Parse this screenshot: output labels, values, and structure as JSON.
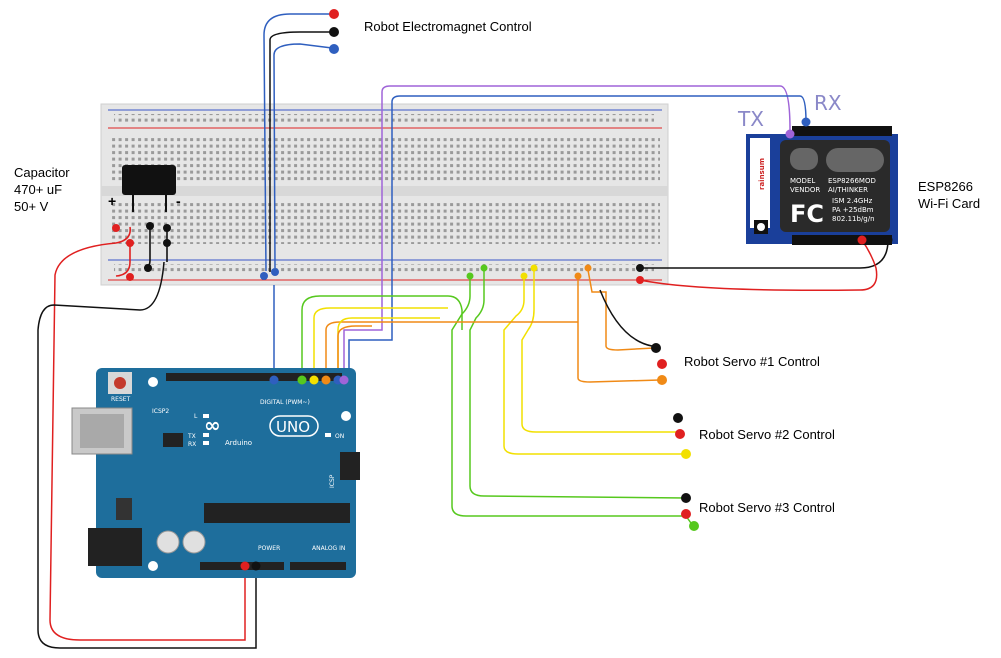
{
  "diagram": {
    "labels": {
      "electromagnet": "Robot Electromagnet Control",
      "capacitor_line1": "Capacitor",
      "capacitor_line2": "470+ uF",
      "capacitor_line3": "50+ V",
      "esp_line1": "ESP8266",
      "esp_line2": "Wi-Fi Card",
      "servo1": "Robot Servo #1 Control",
      "servo2": "Robot Servo #2 Control",
      "servo3": "Robot Servo #3 Control",
      "tx": "TX",
      "rx": "RX",
      "plus": "+",
      "minus": "-"
    },
    "arduino": {
      "logo": "UNO",
      "brand": "Arduino",
      "reset": "RESET",
      "icsp2": "ICSP2",
      "icsp": "ICSP",
      "digital": "DIGITAL (PWM~)",
      "power": "POWER",
      "analog": "ANALOG IN",
      "on": "ON",
      "l": "L",
      "tx": "TX",
      "rx": "RX"
    },
    "esp8266": {
      "brand": "rainsum",
      "model": "MODEL",
      "vendor": "VENDOR",
      "model_value": "ESP8266MOD",
      "vendor_value": "AI/THINKER",
      "spec1": "ISM 2.4GHz",
      "spec2": "PA +25dBm",
      "spec3": "802.11b/g/n",
      "fcc": "FC"
    },
    "colors": {
      "blue": "#2f5fbf",
      "red": "#e02020",
      "black": "#111111",
      "green": "#56c81e",
      "yellow": "#f2e000",
      "orange": "#f08a16",
      "purple": "#9f64d8",
      "board": "#1e6e9c",
      "breadboard": "#e6e6e6"
    }
  }
}
